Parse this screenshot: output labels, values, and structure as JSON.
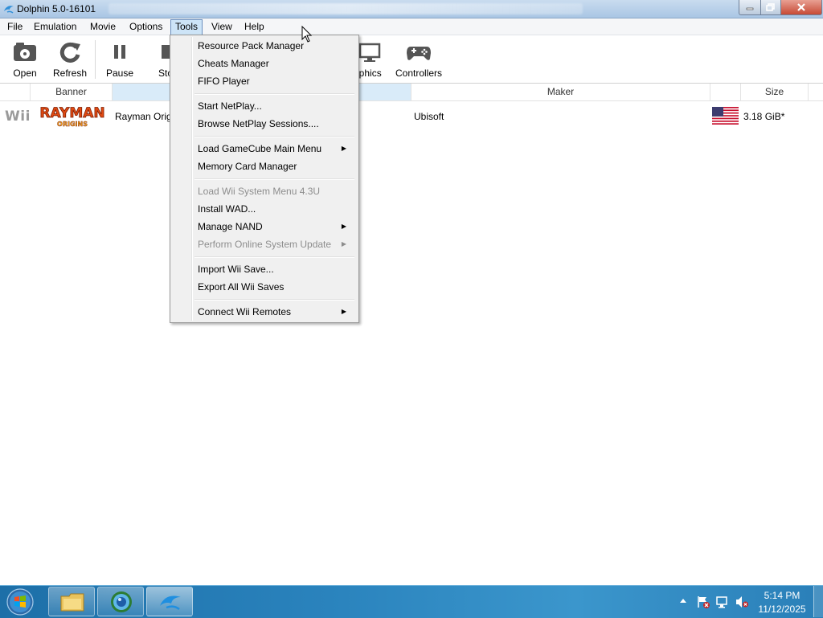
{
  "window": {
    "title": "Dolphin 5.0-16101"
  },
  "menubar": {
    "items": [
      {
        "label": "File"
      },
      {
        "label": "Emulation"
      },
      {
        "label": "Movie"
      },
      {
        "label": "Options"
      },
      {
        "label": "Tools"
      },
      {
        "label": "View"
      },
      {
        "label": "Help"
      }
    ],
    "active": "Tools"
  },
  "toolbar": {
    "open": "Open",
    "refresh": "Refresh",
    "pause": "Pause",
    "stop_partial": "Sto",
    "graphics_partial": "aphics",
    "controllers": "Controllers"
  },
  "columns": {
    "banner": "Banner",
    "maker": "Maker",
    "size": "Size"
  },
  "games": [
    {
      "platform": "Wii",
      "banner_text": "RAYMAN",
      "banner_subtext": "ORIGINS",
      "title_partial": "Rayman Orig",
      "maker": "Ubisoft",
      "region_flag": "us-flag",
      "size": "3.18 GiB*"
    }
  ],
  "tools_menu": {
    "items": [
      {
        "label": "Resource Pack Manager",
        "enabled": true,
        "submenu": false
      },
      {
        "label": "Cheats Manager",
        "enabled": true,
        "submenu": false
      },
      {
        "label": "FIFO Player",
        "enabled": true,
        "submenu": false
      },
      {
        "label": "Start NetPlay...",
        "enabled": true,
        "submenu": false
      },
      {
        "label": "Browse NetPlay Sessions....",
        "enabled": true,
        "submenu": false
      },
      {
        "label": "Load GameCube Main Menu",
        "enabled": true,
        "submenu": true
      },
      {
        "label": "Memory Card Manager",
        "enabled": true,
        "submenu": false
      },
      {
        "label": "Load Wii System Menu 4.3U",
        "enabled": false,
        "submenu": false
      },
      {
        "label": "Install WAD...",
        "enabled": true,
        "submenu": false
      },
      {
        "label": "Manage NAND",
        "enabled": true,
        "submenu": true
      },
      {
        "label": "Perform Online System Update",
        "enabled": false,
        "submenu": true
      },
      {
        "label": "Import Wii Save...",
        "enabled": true,
        "submenu": false
      },
      {
        "label": "Export All Wii Saves",
        "enabled": true,
        "submenu": false
      },
      {
        "label": "Connect Wii Remotes",
        "enabled": true,
        "submenu": true
      }
    ]
  },
  "taskbar": {
    "time": "5:14 PM",
    "date": "11/12/2025",
    "pinned": [
      "file-explorer-icon",
      "browser-icon",
      "dolphin-icon"
    ]
  },
  "colors": {
    "titlebar": "#b4cde8",
    "menu_highlight": "#cde4f7",
    "taskbar": "#2a83bd",
    "disabled_text": "#8d8d8d"
  }
}
